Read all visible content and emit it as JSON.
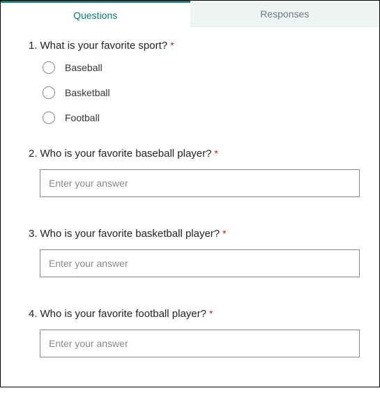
{
  "tabs": {
    "questions": "Questions",
    "responses": "Responses"
  },
  "questions": [
    {
      "num": "1.",
      "text": "What is your favorite sport?",
      "required": "*",
      "type": "choice",
      "options": [
        "Baseball",
        "Basketball",
        "Football"
      ]
    },
    {
      "num": "2.",
      "text": "Who is your favorite baseball player?",
      "required": "*",
      "type": "text",
      "placeholder": "Enter your answer"
    },
    {
      "num": "3.",
      "text": "Who is your favorite basketball player?",
      "required": "*",
      "type": "text",
      "placeholder": "Enter your answer"
    },
    {
      "num": "4.",
      "text": "Who is your favorite football player?",
      "required": "*",
      "type": "text",
      "placeholder": "Enter your answer"
    }
  ]
}
